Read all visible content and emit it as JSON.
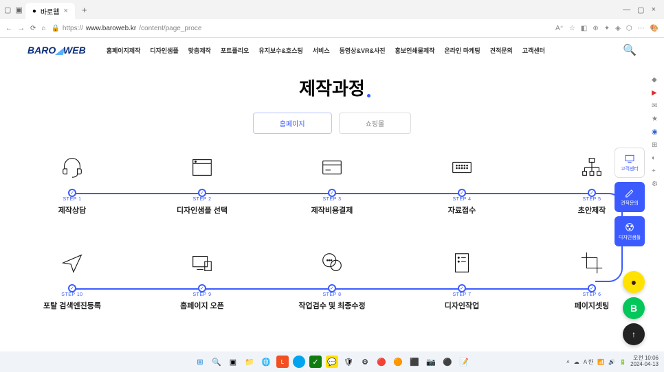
{
  "browser": {
    "tab_title": "바로웹",
    "url_prefix": "https://",
    "url_host": "www.baroweb.kr",
    "url_path": "/content/page_proce"
  },
  "logo": {
    "part1": "BARO",
    "part2": "WEB"
  },
  "nav": [
    "홈페이지제작",
    "디자인샘플",
    "맞춤제작",
    "포트폴리오",
    "유지보수&호스팅",
    "서비스",
    "동영상&VR&사진",
    "홍보인쇄물제작",
    "온라인 마케팅",
    "견적문의",
    "고객센터"
  ],
  "title": "제작과정",
  "tabs": {
    "homepage": "홈페이지",
    "shop": "쇼핑몰"
  },
  "steps_top": [
    {
      "num": "STEP 1",
      "label": "제작상담"
    },
    {
      "num": "STEP 2",
      "label": "디자인샘플 선택"
    },
    {
      "num": "STEP 3",
      "label": "제작비용결제"
    },
    {
      "num": "STEP 4",
      "label": "자료접수"
    },
    {
      "num": "STEP 5",
      "label": "초안제작"
    }
  ],
  "steps_bottom": [
    {
      "num": "STEP 6",
      "label": "페이지셋팅"
    },
    {
      "num": "STEP 7",
      "label": "디자인작업"
    },
    {
      "num": "STEP 8",
      "label": "작업검수 및 최종수정"
    },
    {
      "num": "STEP 9",
      "label": "홈페이지 오픈"
    },
    {
      "num": "STEP 10",
      "label": "포탈 검색엔진등록"
    }
  ],
  "side": {
    "cs": "고객센터",
    "inquiry": "견적문의",
    "sample": "디자인샘플"
  },
  "tray": {
    "time": "오전 10:06",
    "date": "2024-04-13",
    "lang": "A 한"
  }
}
